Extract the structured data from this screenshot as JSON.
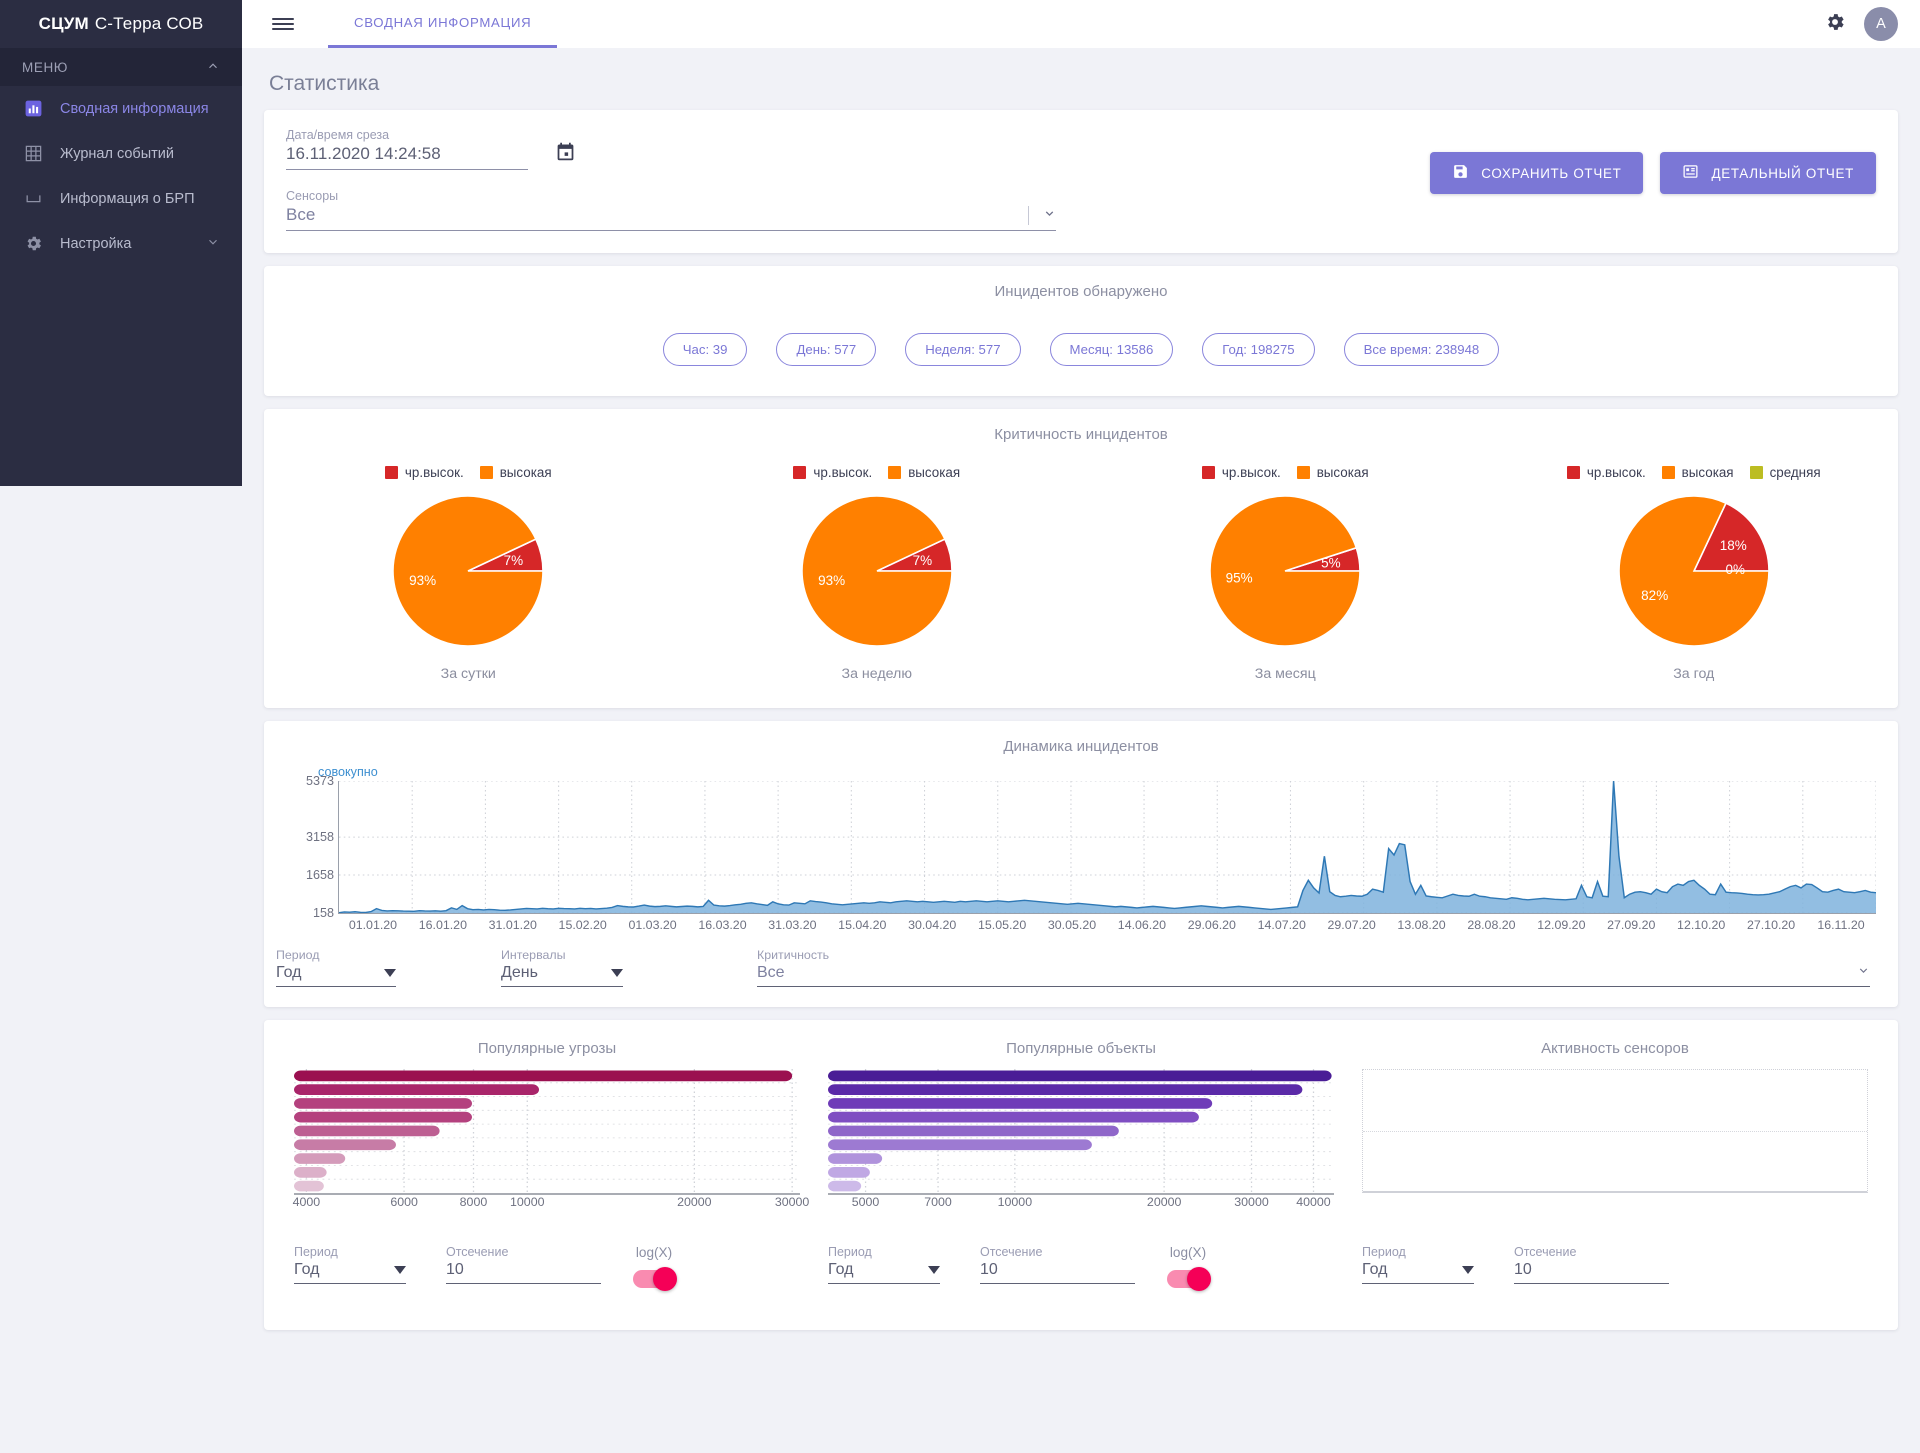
{
  "brand": {
    "bold": "СЦУМ",
    "rest": "С-Терра СОВ"
  },
  "sidebar": {
    "menu_label": "МЕНЮ",
    "items": [
      {
        "label": "Сводная информация",
        "icon": "bar-chart-icon",
        "active": true
      },
      {
        "label": "Журнал событий",
        "icon": "grid-icon",
        "active": false
      },
      {
        "label": "Информация о БРП",
        "icon": "bracket-icon",
        "active": false
      },
      {
        "label": "Настройка",
        "icon": "gear-icon",
        "active": false,
        "chevron": "⌄"
      }
    ]
  },
  "topbar": {
    "tab_label": "СВОДНАЯ ИНФОРМАЦИЯ",
    "avatar_initial": "A"
  },
  "page": {
    "title": "Статистика"
  },
  "filters": {
    "date_label": "Дата/время среза",
    "date_value": "16.11.2020 14:24:58",
    "sensors_label": "Сенсоры",
    "sensors_value": "Все",
    "save_report": "СОХРАНИТЬ ОТЧЕТ",
    "detailed_report": "ДЕТАЛЬНЫЙ ОТЧЕТ"
  },
  "incidents": {
    "title": "Инцидентов обнаружено",
    "chips": [
      "Час: 39",
      "День: 577",
      "Неделя: 577",
      "Месяц: 13586",
      "Год: 198275",
      "Все время: 238948"
    ]
  },
  "criticality": {
    "title": "Критичность инцидентов",
    "colors": {
      "very_high": "#d62728",
      "high": "#ff8000",
      "medium": "#bcbd22"
    }
  },
  "dynamics": {
    "title": "Динамика инцидентов",
    "legend": "совокупно",
    "period_label": "Период",
    "period_value": "Год",
    "intervals_label": "Интервалы",
    "intervals_value": "День",
    "criticality_label": "Критичность",
    "criticality_value": "Все"
  },
  "bottom": {
    "period_label": "Период",
    "period_value": "Год",
    "cutoff_label": "Отсечение",
    "cutoff_value": "10",
    "log_label": "log(X)"
  },
  "chart_data": [
    {
      "type": "pie",
      "title": "За сутки",
      "legend": [
        "чр.высок.",
        "высокая"
      ],
      "labels": [
        "чр.высок.",
        "высокая"
      ],
      "values": [
        7,
        93
      ],
      "data_labels": [
        "7%",
        "93%"
      ],
      "colors": [
        "#d62728",
        "#ff8000"
      ],
      "legend_position": "top"
    },
    {
      "type": "pie",
      "title": "За неделю",
      "legend": [
        "чр.высок.",
        "высокая"
      ],
      "labels": [
        "чр.высок.",
        "высокая"
      ],
      "values": [
        7,
        93
      ],
      "data_labels": [
        "7%",
        "93%"
      ],
      "colors": [
        "#d62728",
        "#ff8000"
      ],
      "legend_position": "top"
    },
    {
      "type": "pie",
      "title": "За месяц",
      "legend": [
        "чр.высок.",
        "высокая"
      ],
      "labels": [
        "чр.высок.",
        "высокая"
      ],
      "values": [
        5,
        95
      ],
      "data_labels": [
        "5%",
        "95%"
      ],
      "colors": [
        "#d62728",
        "#ff8000"
      ],
      "legend_position": "top"
    },
    {
      "type": "pie",
      "title": "За год",
      "legend": [
        "чр.высок.",
        "высокая",
        "средняя"
      ],
      "labels": [
        "чр.высок.",
        "высокая",
        "средняя"
      ],
      "values": [
        18,
        82,
        0
      ],
      "data_labels": [
        "18%",
        "82%",
        "0%"
      ],
      "colors": [
        "#d62728",
        "#ff8000",
        "#bcbd22"
      ],
      "legend_position": "top"
    },
    {
      "type": "area",
      "title": "Динамика инцидентов",
      "series_name": "совокупно",
      "ylabel": "",
      "xlabel": "",
      "ylim": [
        158,
        5373
      ],
      "yticks": [
        158,
        1658,
        3158,
        5373
      ],
      "grid": true,
      "xticks": [
        "01.01.20",
        "16.01.20",
        "31.01.20",
        "15.02.20",
        "01.03.20",
        "16.03.20",
        "31.03.20",
        "15.04.20",
        "30.04.20",
        "15.05.20",
        "30.05.20",
        "14.06.20",
        "29.06.20",
        "14.07.20",
        "29.07.20",
        "13.08.20",
        "28.08.20",
        "12.09.20",
        "27.09.20",
        "12.10.20",
        "27.10.20",
        "16.11.20"
      ],
      "color": "#5b9bd5",
      "values": [
        170,
        200,
        190,
        210,
        185,
        180,
        215,
        330,
        260,
        240,
        250,
        245,
        235,
        230,
        225,
        250,
        240,
        235,
        245,
        230,
        250,
        360,
        300,
        450,
        330,
        290,
        300,
        280,
        300,
        290,
        270,
        265,
        280,
        300,
        320,
        340,
        330,
        320,
        345,
        330,
        320,
        345,
        335,
        330,
        320,
        345,
        330,
        340,
        320,
        335,
        350,
        380,
        450,
        420,
        400,
        395,
        430,
        470,
        430,
        410,
        420,
        440,
        420,
        400,
        415,
        430,
        420,
        400,
        415,
        660,
        470,
        440,
        430,
        450,
        480,
        500,
        540,
        560,
        520,
        490,
        460,
        600,
        520,
        480,
        470,
        560,
        540,
        520,
        640,
        610,
        590,
        560,
        520,
        500,
        480,
        500,
        520,
        540,
        560,
        540,
        560,
        600,
        580,
        560,
        600,
        620,
        640,
        620,
        600,
        620,
        600,
        580,
        600,
        620,
        600,
        580,
        620,
        600,
        620,
        640,
        620,
        600,
        620,
        640,
        620,
        600,
        620,
        640,
        660,
        640,
        620,
        600,
        580,
        560,
        540,
        520,
        500,
        520,
        540,
        520,
        500,
        480,
        460,
        440,
        420,
        400,
        420,
        400,
        380,
        360,
        380,
        400,
        420,
        400,
        380,
        360,
        340,
        360,
        380,
        400,
        420,
        440,
        420,
        400,
        380,
        360,
        380,
        400,
        420,
        400,
        380,
        360,
        340,
        320,
        300,
        320,
        340,
        360,
        380,
        400,
        1050,
        1450,
        1150,
        950,
        2400,
        1000,
        850,
        800,
        820,
        850,
        830,
        820,
        900,
        1100,
        1050,
        980,
        2700,
        2450,
        2900,
        2850,
        1400,
        900,
        1250,
        830,
        800,
        780,
        760,
        830,
        900,
        850,
        830,
        820,
        900,
        820,
        800,
        760,
        740,
        720,
        700,
        760,
        740,
        700,
        680,
        700,
        720,
        740,
        720,
        700,
        690,
        680,
        700,
        720,
        1250,
        800,
        760,
        1400,
        820,
        800,
        5373,
        2400,
        760,
        900,
        980,
        1000,
        960,
        900,
        1100,
        1000,
        960,
        1200,
        1300,
        1250,
        1400,
        1450,
        1250,
        1100,
        900,
        880,
        1300,
        980,
        960,
        950,
        930,
        900,
        880,
        870,
        880,
        900,
        950,
        1000,
        1100,
        1200,
        1250,
        1150,
        1300,
        1280,
        1150,
        1000,
        980,
        1050,
        1100,
        1000,
        980,
        960,
        1000,
        1050,
        980,
        960
      ]
    },
    {
      "type": "bar",
      "orientation": "horizontal",
      "title": "Популярные угрозы",
      "xscale": "log",
      "xticks": [
        4000,
        6000,
        8000,
        10000,
        20000,
        30000
      ],
      "xlim": [
        3800,
        31000
      ],
      "values": [
        30000,
        10500,
        7950,
        7950,
        6950,
        5800,
        4700,
        4350,
        4300
      ],
      "colors": [
        "#9b1050",
        "#a9256a",
        "#b4417e",
        "#b4417e",
        "#bd5f92",
        "#c77ca6",
        "#d49bba",
        "#dcb0c9",
        "#e3c3d6"
      ],
      "grid": true
    },
    {
      "type": "bar",
      "orientation": "horizontal",
      "title": "Популярные объекты",
      "xscale": "log",
      "xticks": [
        5000,
        7000,
        10000,
        20000,
        30000,
        40000
      ],
      "xlim": [
        4200,
        44000
      ],
      "values": [
        43500,
        38000,
        25000,
        23500,
        16200,
        14300,
        5400,
        5100,
        4900
      ],
      "colors": [
        "#4a1d96",
        "#5b2aa8",
        "#6f3cb8",
        "#7f4ec2",
        "#8f66c9",
        "#9d7ad2",
        "#b093dc",
        "#c0a8e4",
        "#cdbae9"
      ],
      "grid": true
    },
    {
      "type": "bar",
      "orientation": "horizontal",
      "title": "Активность сенсоров",
      "values": [],
      "xticks": [],
      "grid": true
    }
  ]
}
